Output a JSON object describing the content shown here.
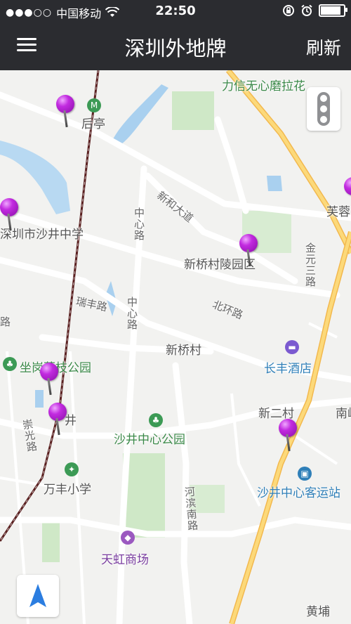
{
  "status": {
    "signal": "●●●○○",
    "carrier": "中国移动",
    "time": "22:50"
  },
  "nav": {
    "title": "深圳外地牌",
    "refresh_label": "刷新"
  },
  "map": {
    "labels": {
      "lixin": "力信无心磨拉花",
      "houting": "后亭",
      "furong": "芙蓉",
      "shajing_middle": "深圳市沙井中学",
      "xinhe_avenue": "新和大道",
      "zhongxin_road_1": "中心路",
      "xinqiao_cemetery": "新桥村陵园区",
      "jinyuan_road": "金元三路",
      "ruifeng_road": "瑞丰路",
      "zhongxin_road_2": "中心路",
      "beihuan_road": "北环路",
      "lu": "路",
      "xinqiao": "新桥村",
      "changfeng_hotel": "长丰酒店",
      "gangang_park": "坐岗荔枝公园",
      "xiner": "新二村",
      "nan": "南峒",
      "jing": "井",
      "chongguang_road": "崇光路",
      "shajing_park": "沙井中心公园",
      "wanfeng_school": "万丰小学",
      "shajing_station": "沙井中心客运站",
      "hebin_road": "河滨南路",
      "tianhong": "天虹商场",
      "huangpu": "黄埔"
    },
    "colors": {
      "pin": "#c22be0",
      "green_label": "#3c8a4a",
      "purple_label": "#7b3fa0",
      "accent": "#2b7de0"
    }
  }
}
